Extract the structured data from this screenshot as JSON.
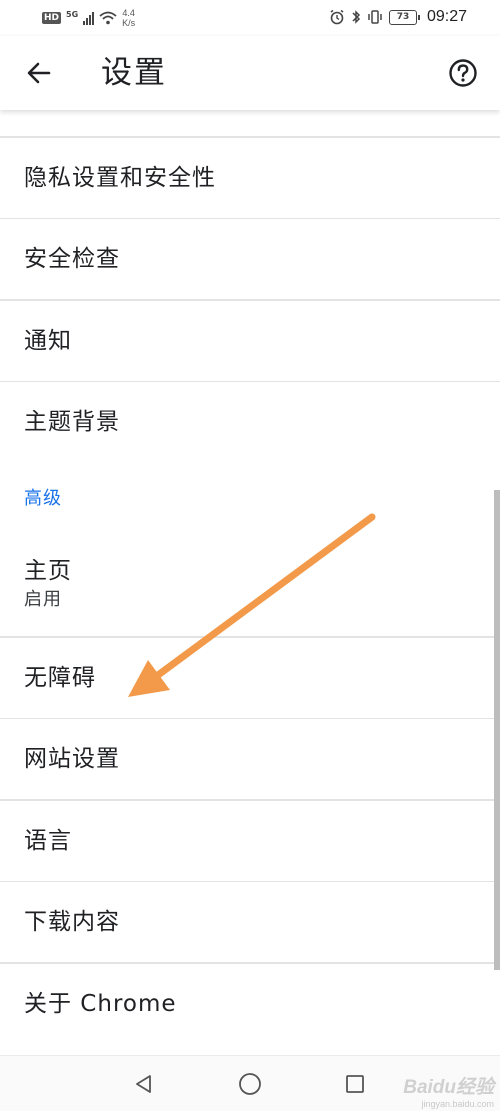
{
  "status_bar": {
    "hd_badge": "HD",
    "network_type": "5G",
    "speed_value": "4.4",
    "speed_unit": "K/s",
    "battery_level": "73",
    "time": "09:27"
  },
  "toolbar": {
    "title": "设置"
  },
  "settings": {
    "items": [
      {
        "label": "隐私设置和安全性"
      },
      {
        "label": "安全检查"
      },
      {
        "label": "通知"
      },
      {
        "label": "主题背景"
      }
    ],
    "advanced_header": "高级",
    "advanced_items": [
      {
        "label": "主页",
        "sublabel": "启用"
      },
      {
        "label": "无障碍"
      },
      {
        "label": "网站设置"
      },
      {
        "label": "语言"
      },
      {
        "label": "下载内容"
      },
      {
        "label": "关于 Chrome"
      }
    ]
  },
  "annotation": {
    "color": "#f29a4a"
  },
  "watermark": {
    "main": "Baidu经验",
    "sub": "jingyan.baidu.com"
  },
  "colors": {
    "accent": "#1a73e8",
    "text": "#202124",
    "divider": "#e3e3e3"
  }
}
